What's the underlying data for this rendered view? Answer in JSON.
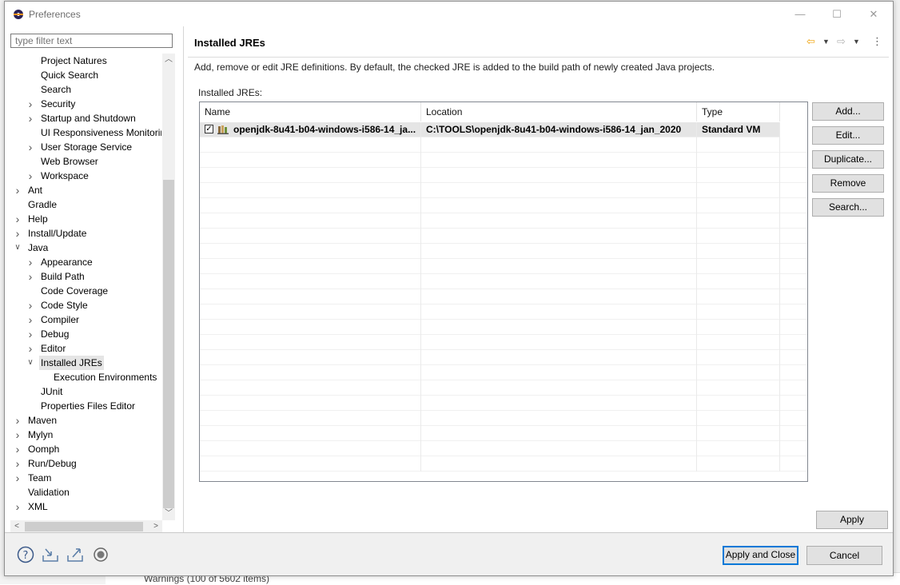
{
  "window": {
    "title": "Preferences",
    "minimize": "—",
    "maximize": "☐",
    "close": "✕"
  },
  "filter": {
    "placeholder": "type filter text",
    "value": ""
  },
  "tree": {
    "items": [
      {
        "label": "Project Natures",
        "level": 1,
        "expander": "none"
      },
      {
        "label": "Quick Search",
        "level": 1,
        "expander": "none"
      },
      {
        "label": "Search",
        "level": 1,
        "expander": "none"
      },
      {
        "label": "Security",
        "level": 1,
        "expander": "collapsed"
      },
      {
        "label": "Startup and Shutdown",
        "level": 1,
        "expander": "collapsed"
      },
      {
        "label": "UI Responsiveness Monitorin",
        "level": 1,
        "expander": "none"
      },
      {
        "label": "User Storage Service",
        "level": 1,
        "expander": "collapsed"
      },
      {
        "label": "Web Browser",
        "level": 1,
        "expander": "none"
      },
      {
        "label": "Workspace",
        "level": 1,
        "expander": "collapsed"
      },
      {
        "label": "Ant",
        "level": 0,
        "expander": "collapsed"
      },
      {
        "label": "Gradle",
        "level": 0,
        "expander": "none"
      },
      {
        "label": "Help",
        "level": 0,
        "expander": "collapsed"
      },
      {
        "label": "Install/Update",
        "level": 0,
        "expander": "collapsed"
      },
      {
        "label": "Java",
        "level": 0,
        "expander": "expanded"
      },
      {
        "label": "Appearance",
        "level": 1,
        "expander": "collapsed"
      },
      {
        "label": "Build Path",
        "level": 1,
        "expander": "collapsed"
      },
      {
        "label": "Code Coverage",
        "level": 1,
        "expander": "none"
      },
      {
        "label": "Code Style",
        "level": 1,
        "expander": "collapsed"
      },
      {
        "label": "Compiler",
        "level": 1,
        "expander": "collapsed"
      },
      {
        "label": "Debug",
        "level": 1,
        "expander": "collapsed"
      },
      {
        "label": "Editor",
        "level": 1,
        "expander": "collapsed"
      },
      {
        "label": "Installed JREs",
        "level": 1,
        "expander": "expanded",
        "selected": true
      },
      {
        "label": "Execution Environments",
        "level": 2,
        "expander": "none"
      },
      {
        "label": "JUnit",
        "level": 1,
        "expander": "none"
      },
      {
        "label": "Properties Files Editor",
        "level": 1,
        "expander": "none"
      },
      {
        "label": "Maven",
        "level": 0,
        "expander": "collapsed"
      },
      {
        "label": "Mylyn",
        "level": 0,
        "expander": "collapsed"
      },
      {
        "label": "Oomph",
        "level": 0,
        "expander": "collapsed"
      },
      {
        "label": "Run/Debug",
        "level": 0,
        "expander": "collapsed"
      },
      {
        "label": "Team",
        "level": 0,
        "expander": "collapsed"
      },
      {
        "label": "Validation",
        "level": 0,
        "expander": "none"
      },
      {
        "label": "XML",
        "level": 0,
        "expander": "collapsed"
      }
    ]
  },
  "page": {
    "title": "Installed JREs",
    "description": "Add, remove or edit JRE definitions. By default, the checked JRE is added to the build path of newly created Java projects.",
    "list_label": "Installed JREs:"
  },
  "table": {
    "columns": [
      "Name",
      "Location",
      "Type"
    ],
    "rows": [
      {
        "checked": true,
        "name": "openjdk-8u41-b04-windows-i586-14_ja...",
        "location": "C:\\TOOLS\\openjdk-8u41-b04-windows-i586-14_jan_2020",
        "type": "Standard VM"
      }
    ]
  },
  "buttons": {
    "add": "Add...",
    "edit": "Edit...",
    "duplicate": "Duplicate...",
    "remove": "Remove",
    "search": "Search...",
    "apply": "Apply",
    "apply_and_close": "Apply and Close",
    "cancel": "Cancel"
  },
  "background": {
    "status_text": "Warnings (100 of 5602 items)"
  },
  "colors": {
    "accent": "#0078d7",
    "selection": "#e5e5e5",
    "back_arrow": "#f0a30a"
  }
}
